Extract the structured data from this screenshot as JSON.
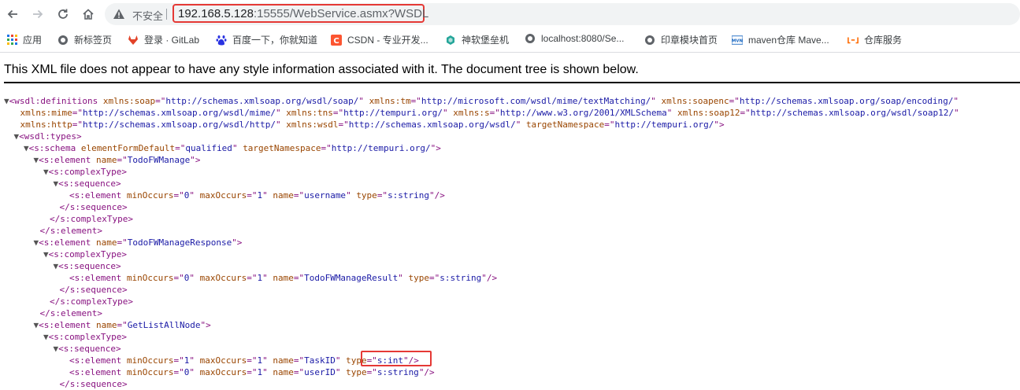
{
  "browser": {
    "insecure_label": "不安全",
    "url_host": "192.168.5.128",
    "url_rest": ":15555/WebService.asmx?WSDL"
  },
  "bookmarks": [
    {
      "label": "应用",
      "icon": "apps-grid-icon"
    },
    {
      "label": "新标签页",
      "icon": "globe-icon"
    },
    {
      "label": "登录 · GitLab",
      "icon": "gitlab-icon"
    },
    {
      "label": "百度一下，你就知道",
      "icon": "baidu-icon"
    },
    {
      "label": "CSDN - 专业开发...",
      "icon": "csdn-icon"
    },
    {
      "label": "神软堡垒机",
      "icon": "fortress-icon"
    },
    {
      "label": "localhost:8080/Se...",
      "icon": "globe-icon"
    },
    {
      "label": "印章模块首页",
      "icon": "globe-icon"
    },
    {
      "label": "maven仓库 Mave...",
      "icon": "maven-icon"
    },
    {
      "label": "仓库服务",
      "icon": "cloud-icon"
    }
  ],
  "notice": "This XML file does not appear to have any style information associated with it. The document tree is shown below.",
  "xml_lines": [
    {
      "indent": 0,
      "toggle": "▼",
      "parts": [
        [
          "t",
          "<wsdl:definitions "
        ],
        [
          "n",
          "xmlns:soap"
        ],
        [
          "t",
          "=\""
        ],
        [
          "v",
          "http://schemas.xmlsoap.org/wsdl/soap/"
        ],
        [
          "t",
          "\" "
        ],
        [
          "n",
          "xmlns:tm"
        ],
        [
          "t",
          "=\""
        ],
        [
          "v",
          "http://microsoft.com/wsdl/mime/textMatching/"
        ],
        [
          "t",
          "\" "
        ],
        [
          "n",
          "xmlns:soapenc"
        ],
        [
          "t",
          "=\""
        ],
        [
          "v",
          "http://schemas.xmlsoap.org/soap/encoding/"
        ],
        [
          "t",
          "\""
        ]
      ]
    },
    {
      "indent": 1,
      "toggle": "",
      "parts": [
        [
          "n",
          "xmlns:mime"
        ],
        [
          "t",
          "=\""
        ],
        [
          "v",
          "http://schemas.xmlsoap.org/wsdl/mime/"
        ],
        [
          "t",
          "\" "
        ],
        [
          "n",
          "xmlns:tns"
        ],
        [
          "t",
          "=\""
        ],
        [
          "v",
          "http://tempuri.org/"
        ],
        [
          "t",
          "\" "
        ],
        [
          "n",
          "xmlns:s"
        ],
        [
          "t",
          "=\""
        ],
        [
          "v",
          "http://www.w3.org/2001/XMLSchema"
        ],
        [
          "t",
          "\" "
        ],
        [
          "n",
          "xmlns:soap12"
        ],
        [
          "t",
          "=\""
        ],
        [
          "v",
          "http://schemas.xmlsoap.org/wsdl/soap12/"
        ],
        [
          "t",
          "\""
        ]
      ]
    },
    {
      "indent": 1,
      "toggle": "",
      "parts": [
        [
          "n",
          "xmlns:http"
        ],
        [
          "t",
          "=\""
        ],
        [
          "v",
          "http://schemas.xmlsoap.org/wsdl/http/"
        ],
        [
          "t",
          "\" "
        ],
        [
          "n",
          "xmlns:wsdl"
        ],
        [
          "t",
          "=\""
        ],
        [
          "v",
          "http://schemas.xmlsoap.org/wsdl/"
        ],
        [
          "t",
          "\" "
        ],
        [
          "n",
          "targetNamespace"
        ],
        [
          "t",
          "=\""
        ],
        [
          "v",
          "http://tempuri.org/"
        ],
        [
          "t",
          "\">"
        ]
      ]
    },
    {
      "indent": 1,
      "toggle": "▼",
      "parts": [
        [
          "t",
          "<wsdl:types>"
        ]
      ]
    },
    {
      "indent": 2,
      "toggle": "▼",
      "parts": [
        [
          "t",
          "<s:schema "
        ],
        [
          "n",
          "elementFormDefault"
        ],
        [
          "t",
          "=\""
        ],
        [
          "v",
          "qualified"
        ],
        [
          "t",
          "\" "
        ],
        [
          "n",
          "targetNamespace"
        ],
        [
          "t",
          "=\""
        ],
        [
          "v",
          "http://tempuri.org/"
        ],
        [
          "t",
          "\">"
        ]
      ]
    },
    {
      "indent": 3,
      "toggle": "▼",
      "parts": [
        [
          "t",
          "<s:element "
        ],
        [
          "n",
          "name"
        ],
        [
          "t",
          "=\""
        ],
        [
          "v",
          "TodoFWManage"
        ],
        [
          "t",
          "\">"
        ]
      ]
    },
    {
      "indent": 4,
      "toggle": "▼",
      "parts": [
        [
          "t",
          "<s:complexType>"
        ]
      ]
    },
    {
      "indent": 5,
      "toggle": "▼",
      "parts": [
        [
          "t",
          "<s:sequence>"
        ]
      ]
    },
    {
      "indent": 6,
      "toggle": "",
      "parts": [
        [
          "t",
          "<s:element "
        ],
        [
          "n",
          "minOccurs"
        ],
        [
          "t",
          "=\""
        ],
        [
          "v",
          "0"
        ],
        [
          "t",
          "\" "
        ],
        [
          "n",
          "maxOccurs"
        ],
        [
          "t",
          "=\""
        ],
        [
          "v",
          "1"
        ],
        [
          "t",
          "\" "
        ],
        [
          "n",
          "name"
        ],
        [
          "t",
          "=\""
        ],
        [
          "v",
          "username"
        ],
        [
          "t",
          "\" "
        ],
        [
          "n",
          "type"
        ],
        [
          "t",
          "=\""
        ],
        [
          "v",
          "s:string"
        ],
        [
          "t",
          "\"/>"
        ]
      ]
    },
    {
      "indent": 5,
      "toggle": "",
      "parts": [
        [
          "t",
          "</s:sequence>"
        ]
      ]
    },
    {
      "indent": 4,
      "toggle": "",
      "parts": [
        [
          "t",
          "</s:complexType>"
        ]
      ]
    },
    {
      "indent": 3,
      "toggle": "",
      "parts": [
        [
          "t",
          "</s:element>"
        ]
      ]
    },
    {
      "indent": 3,
      "toggle": "▼",
      "parts": [
        [
          "t",
          "<s:element "
        ],
        [
          "n",
          "name"
        ],
        [
          "t",
          "=\""
        ],
        [
          "v",
          "TodoFWManageResponse"
        ],
        [
          "t",
          "\">"
        ]
      ]
    },
    {
      "indent": 4,
      "toggle": "▼",
      "parts": [
        [
          "t",
          "<s:complexType>"
        ]
      ]
    },
    {
      "indent": 5,
      "toggle": "▼",
      "parts": [
        [
          "t",
          "<s:sequence>"
        ]
      ]
    },
    {
      "indent": 6,
      "toggle": "",
      "parts": [
        [
          "t",
          "<s:element "
        ],
        [
          "n",
          "minOccurs"
        ],
        [
          "t",
          "=\""
        ],
        [
          "v",
          "0"
        ],
        [
          "t",
          "\" "
        ],
        [
          "n",
          "maxOccurs"
        ],
        [
          "t",
          "=\""
        ],
        [
          "v",
          "1"
        ],
        [
          "t",
          "\" "
        ],
        [
          "n",
          "name"
        ],
        [
          "t",
          "=\""
        ],
        [
          "v",
          "TodoFWManageResult"
        ],
        [
          "t",
          "\" "
        ],
        [
          "n",
          "type"
        ],
        [
          "t",
          "=\""
        ],
        [
          "v",
          "s:string"
        ],
        [
          "t",
          "\"/>"
        ]
      ]
    },
    {
      "indent": 5,
      "toggle": "",
      "parts": [
        [
          "t",
          "</s:sequence>"
        ]
      ]
    },
    {
      "indent": 4,
      "toggle": "",
      "parts": [
        [
          "t",
          "</s:complexType>"
        ]
      ]
    },
    {
      "indent": 3,
      "toggle": "",
      "parts": [
        [
          "t",
          "</s:element>"
        ]
      ]
    },
    {
      "indent": 3,
      "toggle": "▼",
      "parts": [
        [
          "t",
          "<s:element "
        ],
        [
          "n",
          "name"
        ],
        [
          "t",
          "=\""
        ],
        [
          "v",
          "GetListAllNode"
        ],
        [
          "t",
          "\">"
        ]
      ]
    },
    {
      "indent": 4,
      "toggle": "▼",
      "parts": [
        [
          "t",
          "<s:complexType>"
        ]
      ]
    },
    {
      "indent": 5,
      "toggle": "▼",
      "parts": [
        [
          "t",
          "<s:sequence>"
        ]
      ]
    },
    {
      "indent": 6,
      "toggle": "",
      "parts": [
        [
          "t",
          "<s:element "
        ],
        [
          "n",
          "minOccurs"
        ],
        [
          "t",
          "=\""
        ],
        [
          "v",
          "1"
        ],
        [
          "t",
          "\" "
        ],
        [
          "n",
          "maxOccurs"
        ],
        [
          "t",
          "=\""
        ],
        [
          "v",
          "1"
        ],
        [
          "t",
          "\" "
        ],
        [
          "n",
          "name"
        ],
        [
          "t",
          "=\""
        ],
        [
          "v",
          "TaskID"
        ],
        [
          "t",
          "\" "
        ],
        [
          "n",
          "type"
        ],
        [
          "t",
          "=\""
        ],
        [
          "v",
          "s:int"
        ],
        [
          "t",
          "\"/>"
        ]
      ]
    },
    {
      "indent": 6,
      "toggle": "",
      "parts": [
        [
          "t",
          "<s:element "
        ],
        [
          "n",
          "minOccurs"
        ],
        [
          "t",
          "=\""
        ],
        [
          "v",
          "0"
        ],
        [
          "t",
          "\" "
        ],
        [
          "n",
          "maxOccurs"
        ],
        [
          "t",
          "=\""
        ],
        [
          "v",
          "1"
        ],
        [
          "t",
          "\" "
        ],
        [
          "n",
          "name"
        ],
        [
          "t",
          "=\""
        ],
        [
          "v",
          "userID"
        ],
        [
          "t",
          "\" "
        ],
        [
          "n",
          "type"
        ],
        [
          "t",
          "=\""
        ],
        [
          "v",
          "s:string"
        ],
        [
          "t",
          "\"/>"
        ]
      ]
    },
    {
      "indent": 5,
      "toggle": "",
      "parts": [
        [
          "t",
          "</s:sequence>"
        ]
      ]
    }
  ]
}
